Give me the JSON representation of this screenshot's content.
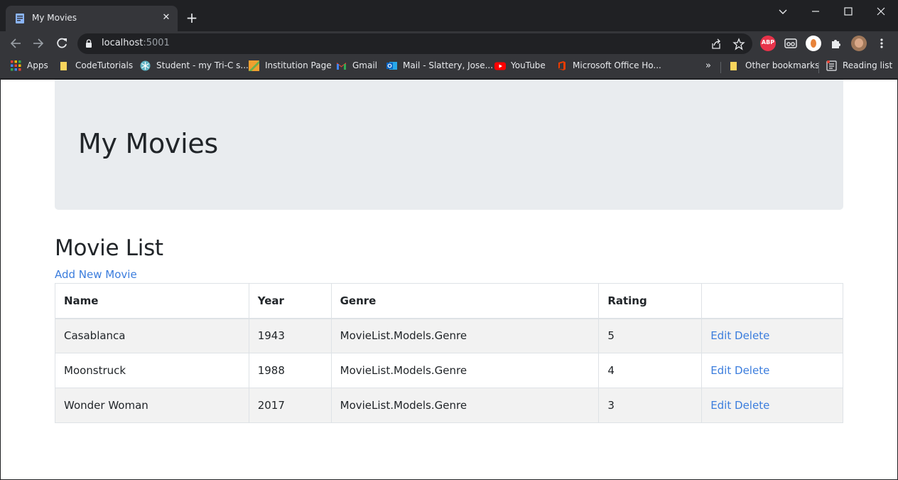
{
  "browser": {
    "tab_title": "My Movies",
    "url_host": "localhost",
    "url_port": ":5001",
    "bookmarks": [
      {
        "label": "Apps",
        "icon": "apps-grid-icon"
      },
      {
        "label": "CodeTutorials",
        "icon": "folder-icon"
      },
      {
        "label": "Student - my Tri-C s...",
        "icon": "snowflake-icon"
      },
      {
        "label": "Institution Page",
        "icon": "pencil-icon"
      },
      {
        "label": "Gmail",
        "icon": "gmail-icon"
      },
      {
        "label": "Mail - Slattery, Jose...",
        "icon": "outlook-icon"
      },
      {
        "label": "YouTube",
        "icon": "youtube-icon"
      },
      {
        "label": "Microsoft Office Ho...",
        "icon": "office-icon"
      }
    ],
    "more_bookmarks": "»",
    "other_bookmarks": "Other bookmarks",
    "reading_list": "Reading list",
    "extensions": [
      "abp-icon",
      "reader-icon",
      "profile-icon",
      "puzzle-icon",
      "avatar"
    ],
    "colors": {
      "chrome_dark": "#202124",
      "chrome_mid": "#35363a",
      "text": "#e8eaed",
      "link": "#3b7ddd"
    }
  },
  "page": {
    "jumbotron_title": "My Movies",
    "section_title": "Movie List",
    "add_link": "Add New Movie",
    "table": {
      "headers": [
        "Name",
        "Year",
        "Genre",
        "Rating",
        ""
      ],
      "rows": [
        {
          "name": "Casablanca",
          "year": "1943",
          "genre": "MovieList.Models.Genre",
          "rating": "5",
          "edit": "Edit",
          "delete": "Delete"
        },
        {
          "name": "Moonstruck",
          "year": "1988",
          "genre": "MovieList.Models.Genre",
          "rating": "4",
          "edit": "Edit",
          "delete": "Delete"
        },
        {
          "name": "Wonder Woman",
          "year": "2017",
          "genre": "MovieList.Models.Genre",
          "rating": "3",
          "edit": "Edit",
          "delete": "Delete"
        }
      ]
    }
  }
}
